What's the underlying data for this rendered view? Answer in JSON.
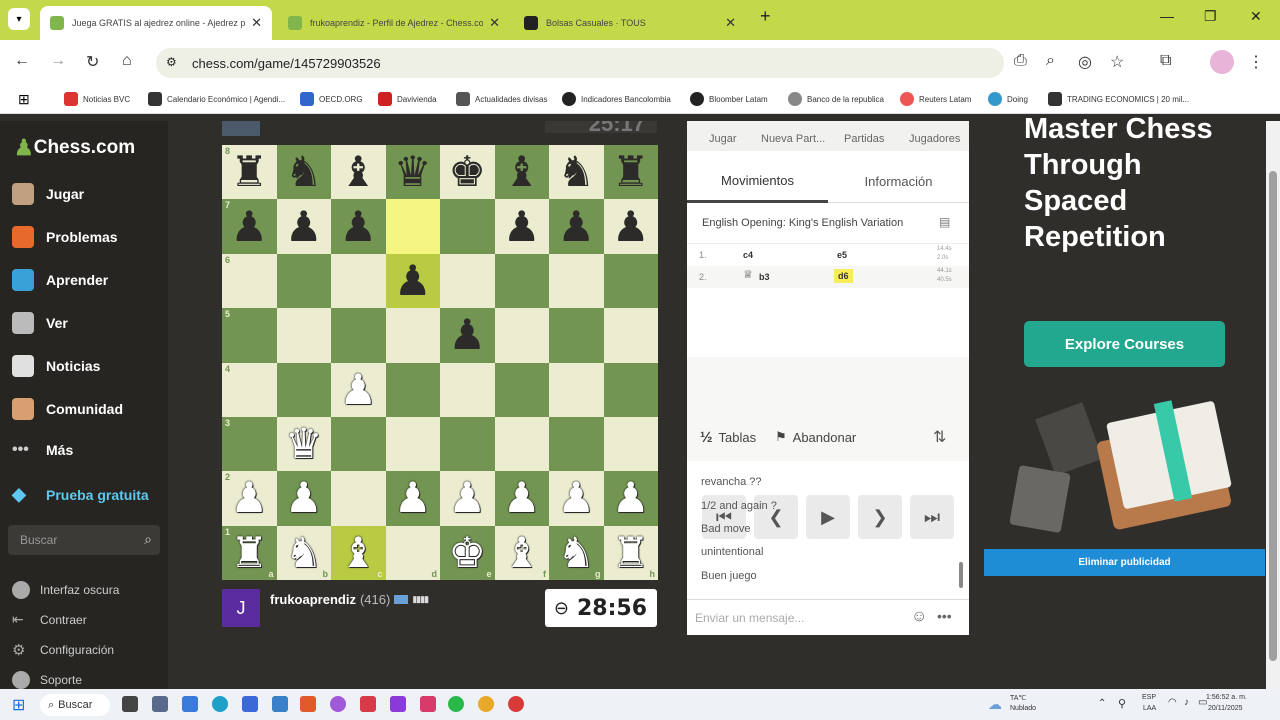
{
  "browser": {
    "tabs": [
      {
        "title": "Juega GRATIS al ajedrez online - Ajedrez para J",
        "active": true
      },
      {
        "title": "frukoaprendiz - Perfil de Ajedrez - Chess.com",
        "active": false
      },
      {
        "title": "Bolsas Casuales · TOUS",
        "active": false
      }
    ],
    "url": "chess.com/game/145729903526",
    "bookmarks": [
      "Noticias BVC",
      "Calendario Económico | Agendi...",
      "OECD.ORG",
      "Davivienda",
      "Actualidades divisas",
      "Indicadores Bancolombia",
      "Bloomber Latam",
      "Banco de la republica",
      "Reuters Latam",
      "Doing",
      "TRADING ECONOMICS | 20 mil..."
    ]
  },
  "sidebar": {
    "logo": "Chess.com",
    "items": [
      "Jugar",
      "Problemas",
      "Aprender",
      "Ver",
      "Noticias",
      "Comunidad",
      "Más"
    ],
    "trial": "Prueba gratuita",
    "search_placeholder": "Buscar",
    "settings": [
      "Interfaz oscura",
      "Contraer",
      "Configuración",
      "Soporte"
    ]
  },
  "board": {
    "top_timer": "25:17",
    "ranks": [
      "8",
      "7",
      "6",
      "5",
      "4",
      "3",
      "2",
      "1"
    ],
    "files": [
      "a",
      "b",
      "c",
      "d",
      "e",
      "f",
      "g",
      "h"
    ],
    "position": [
      [
        "br",
        "bn",
        "bb",
        "bq",
        "bk",
        "bb",
        "bn",
        "br"
      ],
      [
        "bp",
        "bp",
        "bp",
        "",
        "",
        "bp",
        "bp",
        "bp"
      ],
      [
        "",
        "",
        "",
        "bp",
        "",
        "",
        "",
        ""
      ],
      [
        "",
        "",
        "",
        "",
        "bp",
        "",
        "",
        ""
      ],
      [
        "",
        "",
        "wp",
        "",
        "",
        "",
        "",
        ""
      ],
      [
        "",
        "wq",
        "",
        "",
        "",
        "",
        "",
        ""
      ],
      [
        "wp",
        "wp",
        "",
        "wp",
        "wp",
        "wp",
        "wp",
        "wp"
      ],
      [
        "wr",
        "wn",
        "wb",
        "",
        "wk",
        "wb",
        "wn",
        "wr"
      ]
    ],
    "highlights": [
      "d7",
      "d6",
      "c1"
    ]
  },
  "player": {
    "avatar": "J",
    "name": "frukoaprendiz",
    "rating": "(416)",
    "timer": "28:56"
  },
  "panel": {
    "top_tabs": [
      "Jugar",
      "Nueva Part...",
      "Partidas",
      "Jugadores"
    ],
    "tabs": [
      "Movimientos",
      "Información"
    ],
    "opening": "English Opening: King's English Variation",
    "moves": [
      {
        "num": "1.",
        "white": "c4",
        "black": "e5",
        "t1": "14.4s",
        "t2": "2.0s"
      },
      {
        "num": "2.",
        "white": "b3",
        "black": "d6",
        "t1": "44.1s",
        "t2": "40.5s"
      }
    ],
    "draw": "Tablas",
    "resign": "Abandonar",
    "chat": [
      "revancha ??",
      "1/2 and again ?",
      "Bad move",
      "unintentional",
      "Buen juego"
    ],
    "chat_placeholder": "Enviar un mensaje..."
  },
  "ad": {
    "headline": "Master Chess Through Spaced Repetition",
    "button": "Explore Courses",
    "remove": "Eliminar publicidad"
  },
  "taskbar": {
    "search": "Buscar",
    "weather_temp": "TA℃",
    "weather": "Nublado",
    "lang": "ESP",
    "lang2": "LAA",
    "time": "1:56:52 a. m.",
    "date": "20/11/2025"
  }
}
